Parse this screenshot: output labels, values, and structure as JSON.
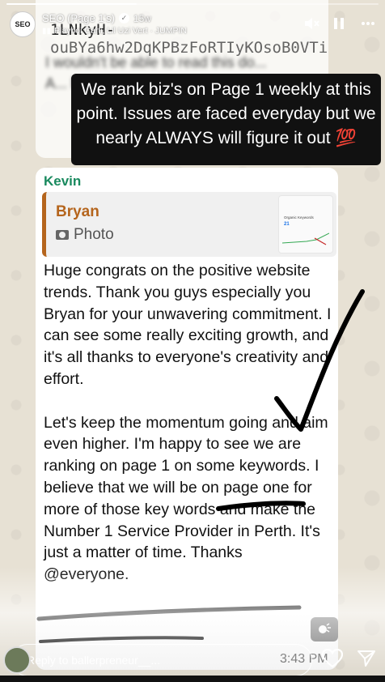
{
  "story": {
    "progress": 0.35,
    "account_name": "SEO (Page 1's)",
    "time_ago": "15w",
    "avatar_text": "SEO",
    "music": "Playboi Carti, Lil Uzi Vert · JUMPIN"
  },
  "top_message": {
    "line1": "1LNkyH-",
    "line2": "ouBYa6hw2DqKPBzFoRTIyKOsoB0VTiU",
    "ghost_text": "I wouldn't be able to read this do... A... be..."
  },
  "caption": {
    "text": "We rank biz's on Page 1 weekly at this point. Issues are faced everyday but we nearly ALWAYS will figure it out 💯"
  },
  "message": {
    "sender": "Kevin",
    "quoted_author": "Bryan",
    "quoted_media": "Photo",
    "quoted_thumb_label": "Organic Keywords",
    "quoted_thumb_value": "21",
    "body": "Huge congrats on the positive website trends. Thank you guys especially you Bryan for your unwavering commitment. I can see some really exciting growth, and it's all thanks to everyone's creativity and effort.\n\nLet's keep the momentum going and aim even higher. I'm happy to see we are ranking on page 1 on some keywords. I believe that we will be on page one for more of those key words and make                                the Number 1 Service Provider in Perth. It's just a matter of time. Thanks @everyone.",
    "time": "3:43 PM"
  },
  "reply": {
    "placeholder": "Reply to ballerpreneur__..."
  },
  "colors": {
    "sender": "#1a8a5f",
    "quote_accent": "#b5651d",
    "caption_bg": "#111111"
  }
}
